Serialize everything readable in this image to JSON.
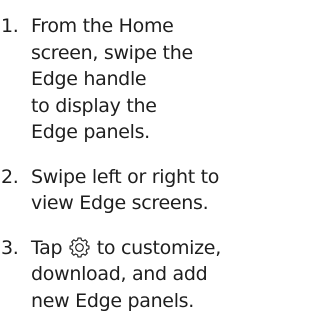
{
  "colors": {
    "text": "#1e1e1e",
    "background": "#ffffff"
  },
  "steps": [
    {
      "number": "1.",
      "lines": [
        "From the Home",
        "screen, swipe the",
        "Edge handle",
        "to display the",
        "Edge panels."
      ]
    },
    {
      "number": "2.",
      "lines": [
        "Swipe left or right to",
        "view Edge screens."
      ]
    },
    {
      "number": "3.",
      "line1_before": "Tap",
      "icon": "settings-gear-icon",
      "line1_after": "to customize,",
      "lines": [
        "download, and add",
        "new Edge panels."
      ]
    }
  ]
}
